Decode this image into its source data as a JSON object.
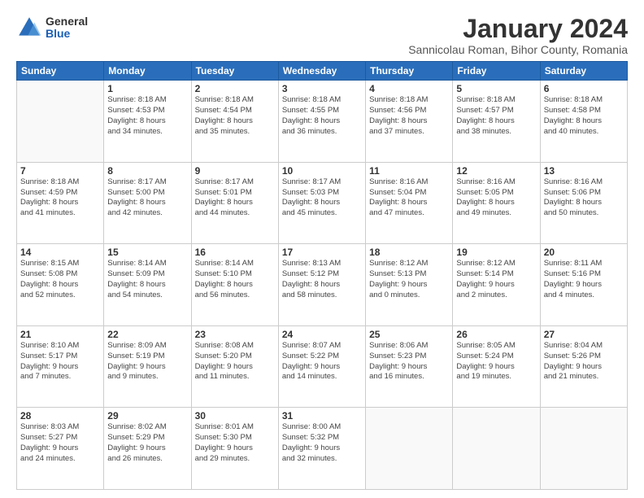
{
  "logo": {
    "general": "General",
    "blue": "Blue"
  },
  "title": "January 2024",
  "subtitle": "Sannicolau Roman, Bihor County, Romania",
  "headers": [
    "Sunday",
    "Monday",
    "Tuesday",
    "Wednesday",
    "Thursday",
    "Friday",
    "Saturday"
  ],
  "weeks": [
    [
      {
        "day": "",
        "info": ""
      },
      {
        "day": "1",
        "info": "Sunrise: 8:18 AM\nSunset: 4:53 PM\nDaylight: 8 hours\nand 34 minutes."
      },
      {
        "day": "2",
        "info": "Sunrise: 8:18 AM\nSunset: 4:54 PM\nDaylight: 8 hours\nand 35 minutes."
      },
      {
        "day": "3",
        "info": "Sunrise: 8:18 AM\nSunset: 4:55 PM\nDaylight: 8 hours\nand 36 minutes."
      },
      {
        "day": "4",
        "info": "Sunrise: 8:18 AM\nSunset: 4:56 PM\nDaylight: 8 hours\nand 37 minutes."
      },
      {
        "day": "5",
        "info": "Sunrise: 8:18 AM\nSunset: 4:57 PM\nDaylight: 8 hours\nand 38 minutes."
      },
      {
        "day": "6",
        "info": "Sunrise: 8:18 AM\nSunset: 4:58 PM\nDaylight: 8 hours\nand 40 minutes."
      }
    ],
    [
      {
        "day": "7",
        "info": "Sunrise: 8:18 AM\nSunset: 4:59 PM\nDaylight: 8 hours\nand 41 minutes."
      },
      {
        "day": "8",
        "info": "Sunrise: 8:17 AM\nSunset: 5:00 PM\nDaylight: 8 hours\nand 42 minutes."
      },
      {
        "day": "9",
        "info": "Sunrise: 8:17 AM\nSunset: 5:01 PM\nDaylight: 8 hours\nand 44 minutes."
      },
      {
        "day": "10",
        "info": "Sunrise: 8:17 AM\nSunset: 5:03 PM\nDaylight: 8 hours\nand 45 minutes."
      },
      {
        "day": "11",
        "info": "Sunrise: 8:16 AM\nSunset: 5:04 PM\nDaylight: 8 hours\nand 47 minutes."
      },
      {
        "day": "12",
        "info": "Sunrise: 8:16 AM\nSunset: 5:05 PM\nDaylight: 8 hours\nand 49 minutes."
      },
      {
        "day": "13",
        "info": "Sunrise: 8:16 AM\nSunset: 5:06 PM\nDaylight: 8 hours\nand 50 minutes."
      }
    ],
    [
      {
        "day": "14",
        "info": "Sunrise: 8:15 AM\nSunset: 5:08 PM\nDaylight: 8 hours\nand 52 minutes."
      },
      {
        "day": "15",
        "info": "Sunrise: 8:14 AM\nSunset: 5:09 PM\nDaylight: 8 hours\nand 54 minutes."
      },
      {
        "day": "16",
        "info": "Sunrise: 8:14 AM\nSunset: 5:10 PM\nDaylight: 8 hours\nand 56 minutes."
      },
      {
        "day": "17",
        "info": "Sunrise: 8:13 AM\nSunset: 5:12 PM\nDaylight: 8 hours\nand 58 minutes."
      },
      {
        "day": "18",
        "info": "Sunrise: 8:12 AM\nSunset: 5:13 PM\nDaylight: 9 hours\nand 0 minutes."
      },
      {
        "day": "19",
        "info": "Sunrise: 8:12 AM\nSunset: 5:14 PM\nDaylight: 9 hours\nand 2 minutes."
      },
      {
        "day": "20",
        "info": "Sunrise: 8:11 AM\nSunset: 5:16 PM\nDaylight: 9 hours\nand 4 minutes."
      }
    ],
    [
      {
        "day": "21",
        "info": "Sunrise: 8:10 AM\nSunset: 5:17 PM\nDaylight: 9 hours\nand 7 minutes."
      },
      {
        "day": "22",
        "info": "Sunrise: 8:09 AM\nSunset: 5:19 PM\nDaylight: 9 hours\nand 9 minutes."
      },
      {
        "day": "23",
        "info": "Sunrise: 8:08 AM\nSunset: 5:20 PM\nDaylight: 9 hours\nand 11 minutes."
      },
      {
        "day": "24",
        "info": "Sunrise: 8:07 AM\nSunset: 5:22 PM\nDaylight: 9 hours\nand 14 minutes."
      },
      {
        "day": "25",
        "info": "Sunrise: 8:06 AM\nSunset: 5:23 PM\nDaylight: 9 hours\nand 16 minutes."
      },
      {
        "day": "26",
        "info": "Sunrise: 8:05 AM\nSunset: 5:24 PM\nDaylight: 9 hours\nand 19 minutes."
      },
      {
        "day": "27",
        "info": "Sunrise: 8:04 AM\nSunset: 5:26 PM\nDaylight: 9 hours\nand 21 minutes."
      }
    ],
    [
      {
        "day": "28",
        "info": "Sunrise: 8:03 AM\nSunset: 5:27 PM\nDaylight: 9 hours\nand 24 minutes."
      },
      {
        "day": "29",
        "info": "Sunrise: 8:02 AM\nSunset: 5:29 PM\nDaylight: 9 hours\nand 26 minutes."
      },
      {
        "day": "30",
        "info": "Sunrise: 8:01 AM\nSunset: 5:30 PM\nDaylight: 9 hours\nand 29 minutes."
      },
      {
        "day": "31",
        "info": "Sunrise: 8:00 AM\nSunset: 5:32 PM\nDaylight: 9 hours\nand 32 minutes."
      },
      {
        "day": "",
        "info": ""
      },
      {
        "day": "",
        "info": ""
      },
      {
        "day": "",
        "info": ""
      }
    ]
  ]
}
